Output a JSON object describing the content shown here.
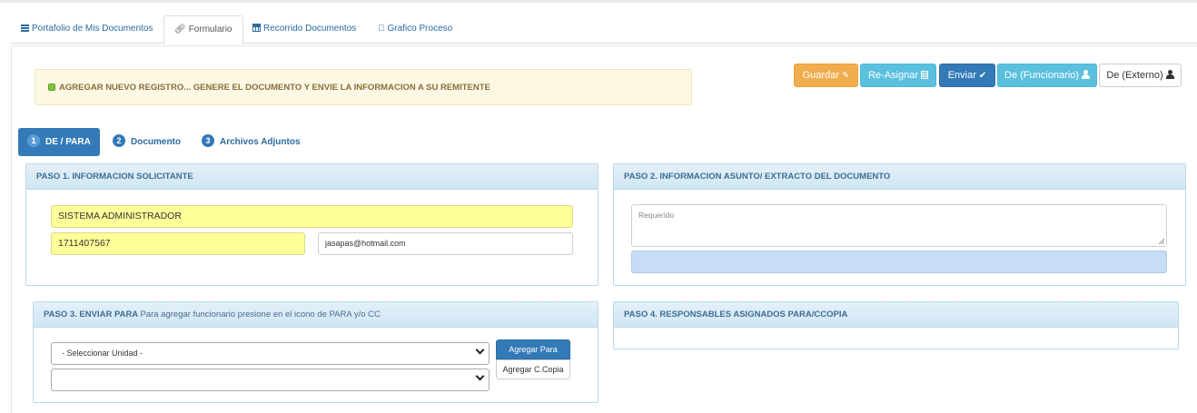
{
  "tabs": [
    {
      "label": "Portafolio de Mis Documentos",
      "icon": "list-icon"
    },
    {
      "label": "Formulario",
      "icon": "link-icon"
    },
    {
      "label": "Recorrido Documentos",
      "icon": "table-icon"
    },
    {
      "label": "Grafico Proceso",
      "icon": "apple-icon"
    }
  ],
  "alert": {
    "text": "AGREGAR NUEVO REGISTRO... GENERE EL DOCUMENTO Y ENVIE LA INFORMACION A SU REMITENTE"
  },
  "actions": {
    "guardar": "Guardar",
    "reasignar": "Re-Asignar",
    "enviar": "Enviar",
    "funcionario": "De (Funcionario)",
    "externo": "De (Externo)"
  },
  "steps": [
    {
      "num": "1",
      "label": "DE / PARA"
    },
    {
      "num": "2",
      "label": "Documento"
    },
    {
      "num": "3",
      "label": "Archivos Adjuntos"
    }
  ],
  "paso1": {
    "title": "PASO 1. INFORMACION SOLICITANTE",
    "name": "SISTEMA ADMINISTRADOR",
    "id_number": "1711407567",
    "email": "jasapas@hotmail.com"
  },
  "paso2": {
    "title": "PASO 2. INFORMACION ASUNTO/ EXTRACTO DEL DOCUMENTO",
    "placeholder": "Requerido"
  },
  "paso3": {
    "title": "PASO 3. ENVIAR PARA",
    "subtitle": "Para agregar funcionario presione en el icono de PARA y/o CC",
    "unit_select": "- Seleccionar Unidad -",
    "agregar_para": "Agregar Para",
    "agregar_copia": "Agregar C.Copia"
  },
  "paso4": {
    "title": "PASO 4. RESPONSABLES ASIGNADOS PARA/CCOPIA"
  },
  "colors": {
    "primary": "#337ab7",
    "info": "#5bc0de",
    "warning": "#f0ad4e",
    "highlight": "#ffff99"
  }
}
